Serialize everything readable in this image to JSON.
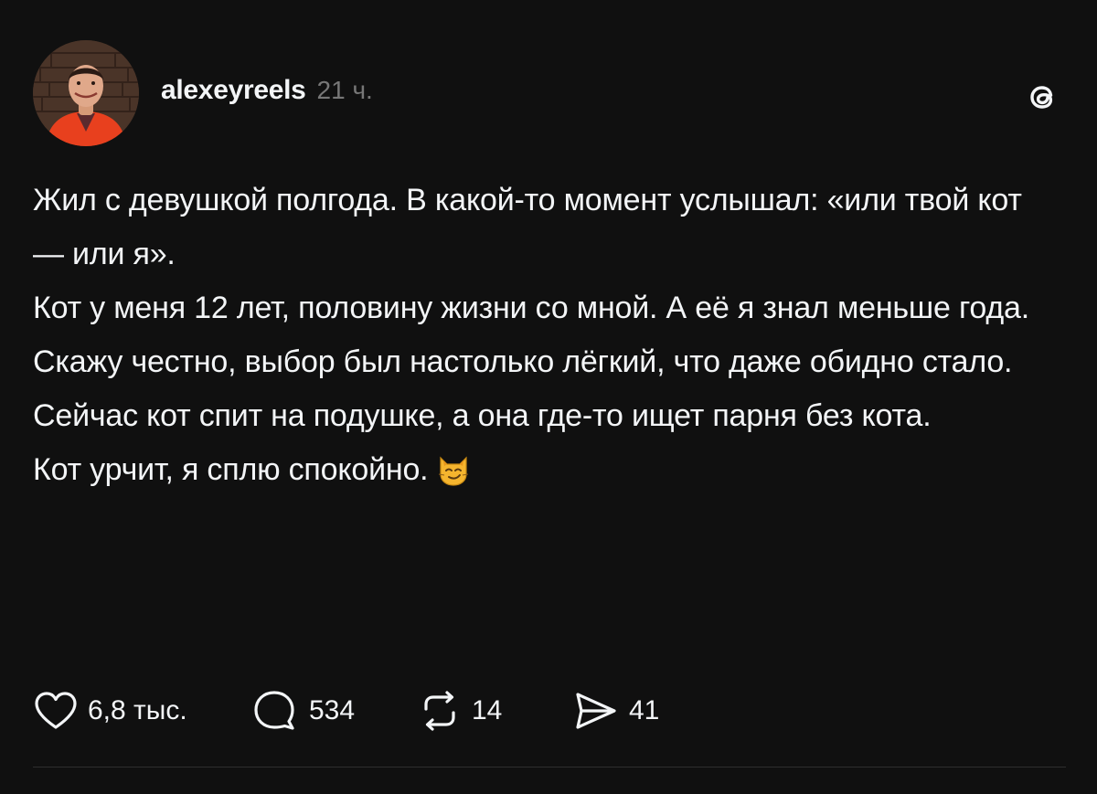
{
  "post": {
    "username": "alexeyreels",
    "timestamp": "21 ч.",
    "avatar_icon": "user-avatar-photo",
    "app_icon": "threads-logo-icon",
    "paragraphs": [
      "Жил с девушкой полгода. В какой-то момент услышал: «или твой кот — или я».",
      "Кот у меня 12 лет, половину жизни со мной. А её я знал меньше года.",
      "Скажу честно, выбор был настолько лёгкий, что даже обидно стало.",
      "Сейчас кот спит на подушке, а она где-то ищет парня без кота."
    ],
    "last_paragraph": "Кот урчит, я сплю спокойно.",
    "last_paragraph_emoji": "smirking-cat-emoji"
  },
  "actions": {
    "likes": "6,8 тыс.",
    "replies": "534",
    "reposts": "14",
    "shares": "41"
  },
  "colors": {
    "background": "#101010",
    "text": "#f3f5f7",
    "muted": "#777777",
    "divider": "#2e2e2e"
  }
}
